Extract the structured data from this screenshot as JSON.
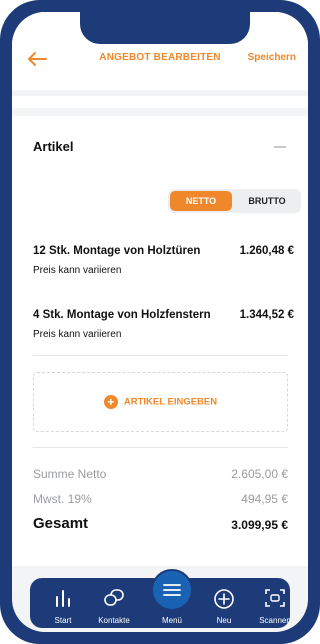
{
  "header": {
    "title": "ANGEBOT BEARBEITEN",
    "save_label": "Speichern",
    "back_icon": "arrow-left-icon"
  },
  "section": {
    "title": "Artikel"
  },
  "toggle": {
    "active": "NETTO",
    "inactive": "BRUTTO"
  },
  "items": [
    {
      "name": "12  Stk. Montage von Holztüren",
      "price": "1.260,48 €",
      "note": "Preis kann variieren"
    },
    {
      "name": "4  Stk. Montage von Holzfenstern",
      "price": "1.344,52 €",
      "note": "Preis kann variieren"
    }
  ],
  "add_article": {
    "label": "ARTIKEL EINGEBEN",
    "icon": "plus-circle-icon"
  },
  "summary": {
    "netto_label": "Summe Netto",
    "netto_value": "2.605,00 €",
    "tax_label": "Mwst. 19%",
    "tax_value": "494,95 €",
    "total_label": "Gesamt",
    "total_value": "3.099,95 €"
  },
  "tabbar": {
    "start": "Start",
    "contacts": "Kontakte",
    "menu": "Menü",
    "new": "Neu",
    "scan": "Scannen"
  },
  "colors": {
    "accent": "#f0882b",
    "navy": "#1c3b78"
  }
}
